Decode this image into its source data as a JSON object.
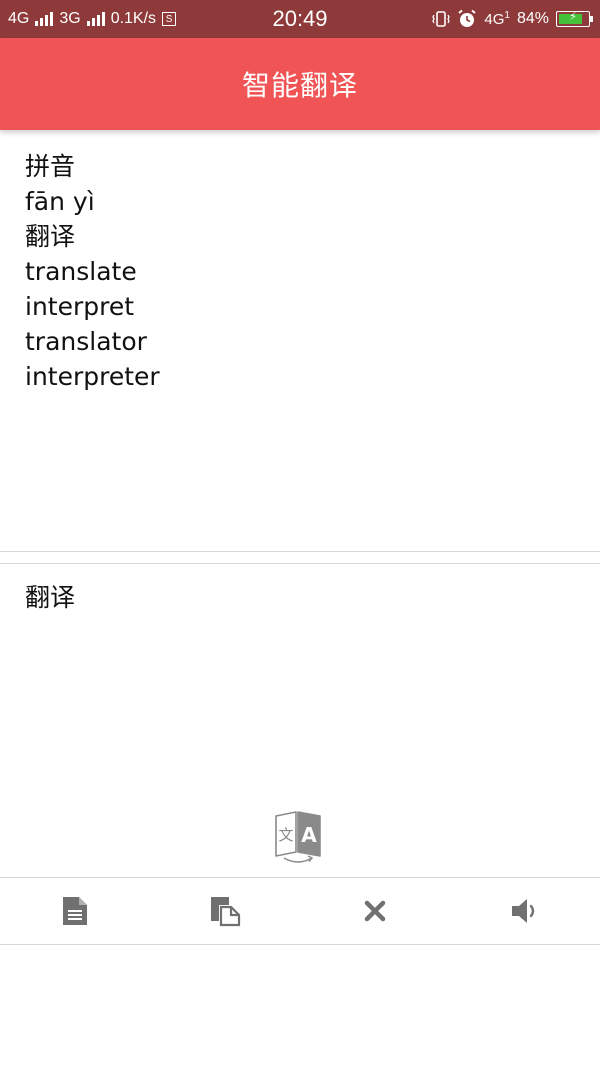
{
  "status_bar": {
    "net1": "4G",
    "net2": "3G",
    "speed": "0.1K/s",
    "s_badge": "S",
    "time": "20:49",
    "net3": "4G",
    "net3_sub": "1",
    "battery": "84%",
    "battery_level": 0.84,
    "battery_color": "#46c23a"
  },
  "header": {
    "title": "智能翻译",
    "color": "#f05454"
  },
  "result": {
    "lines": [
      "拼音",
      "fān yì",
      "翻译",
      "translate",
      "interpret",
      "translator",
      "interpreter"
    ]
  },
  "input": {
    "text": "翻译"
  },
  "translate_button": {
    "icon": "translate-icon",
    "glyph_left": "文",
    "glyph_right": "A"
  },
  "toolbar": {
    "buttons": [
      {
        "icon": "document-icon"
      },
      {
        "icon": "paste-icon"
      },
      {
        "icon": "close-icon"
      },
      {
        "icon": "speaker-icon"
      }
    ]
  }
}
